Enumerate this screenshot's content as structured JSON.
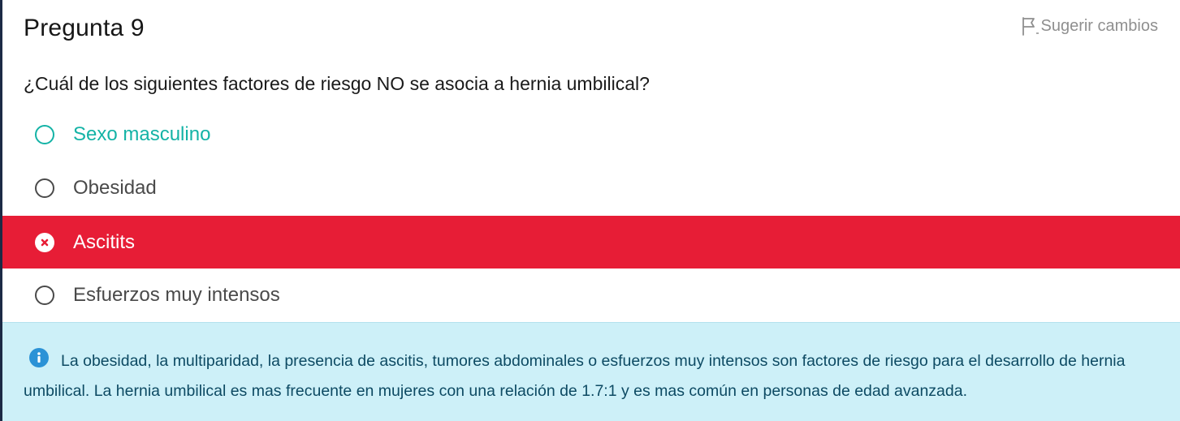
{
  "header": {
    "title": "Pregunta 9",
    "suggest_label": "Sugerir cambios",
    "suggest_icon": "flag-icon"
  },
  "question": {
    "text": "¿Cuál de los siguientes factores de riesgo NO se asocia a hernia umbilical?"
  },
  "options": [
    {
      "label": "Sexo masculino",
      "state": "correct",
      "icon": "radio-empty-icon",
      "color": "#14b3a6"
    },
    {
      "label": "Obesidad",
      "state": "neutral",
      "icon": "radio-empty-icon",
      "color": "#4a4a4a"
    },
    {
      "label": "Ascitits",
      "state": "wrong",
      "icon": "x-circle-icon",
      "color": "#e71d36"
    },
    {
      "label": "Esfuerzos muy intensos",
      "state": "neutral",
      "icon": "radio-empty-icon",
      "color": "#4a4a4a"
    }
  ],
  "explanation": {
    "icon": "info-icon",
    "text": "La obesidad, la multiparidad, la presencia de ascitis, tumores abdominales o esfuerzos muy intensos son factores de riesgo para el desarrollo de hernia umbilical. La hernia umbilical es mas frecuente en mujeres con una relación de 1.7:1 y es mas común en personas de edad avanzada.",
    "background": "#cdf0f8"
  }
}
